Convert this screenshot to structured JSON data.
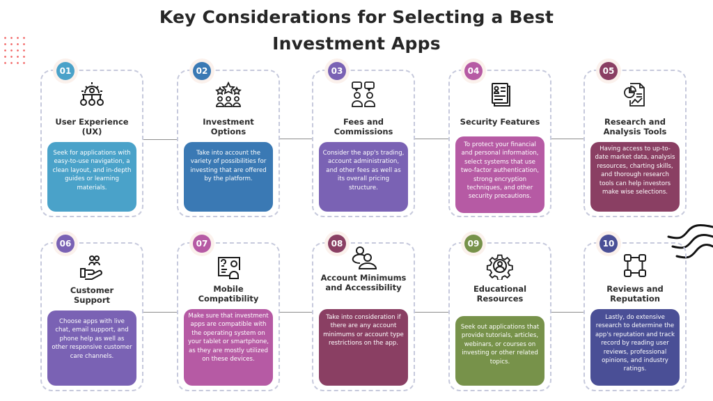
{
  "title": {
    "line1": "Key Considerations for Selecting a Best",
    "line2": "Investment Apps"
  },
  "colors": {
    "c01": "#4aa2c9",
    "c02": "#3a79b4",
    "c03": "#7a62b4",
    "c04": "#b65aa4",
    "c05": "#8a3f63",
    "c06": "#7a62b4",
    "c07": "#b65aa4",
    "c08": "#8a3f63",
    "c09": "#77924a",
    "c10": "#4a4f96",
    "dashed_border": "#c6c9dc",
    "dots": "#f26b6b"
  },
  "cards": [
    {
      "number": "01",
      "icon": "ux-gear-network-icon",
      "heading": "User Experience (UX)",
      "description": "Seek for applications with easy-to-use navigation, a clean layout, and in-depth guides or learning materials."
    },
    {
      "number": "02",
      "icon": "stars-people-icon",
      "heading": "Investment Options",
      "description": "Take into account the variety of possibilities for investing that are offered by the platform."
    },
    {
      "number": "03",
      "icon": "people-chat-icon",
      "heading": "Fees and Commissions",
      "description": "Consider the app's trading, account administration, and other fees as well as its overall pricing structure."
    },
    {
      "number": "04",
      "icon": "profile-document-icon",
      "heading": "Security Features",
      "description": "To protect your financial and personal information, select systems that use two-factor authentication, strong encryption techniques, and other security precautions."
    },
    {
      "number": "05",
      "icon": "report-chart-icon",
      "heading": "Research and Analysis Tools",
      "description": "Having access to up-to-date market data, analysis resources, charting skills, and thorough research tools can help investors make wise selections."
    },
    {
      "number": "06",
      "icon": "hand-people-icon",
      "heading": "Customer Support",
      "description": "Choose apps with live chat, email support, and phone help as well as other responsive customer care channels."
    },
    {
      "number": "07",
      "icon": "profile-card-icon",
      "heading": "Mobile Compatibility",
      "description": "Make sure that investment apps are compatible with the operating system on your tablet or smartphone, as they are mostly utilized on these devices."
    },
    {
      "number": "08",
      "icon": "users-group-icon",
      "heading": "Account Minimums and Accessibility",
      "description": "Take into consideration if there are any account minimums or account type restrictions on the app."
    },
    {
      "number": "09",
      "icon": "gear-user-icon",
      "heading": "Educational Resources",
      "description": "Seek out applications that provide tutorials, articles, webinars, or courses on investing or other related topics."
    },
    {
      "number": "10",
      "icon": "workflow-nodes-icon",
      "heading": "Reviews and Reputation",
      "description": "Lastly, do extensive research to determine the app's reputation and track record by reading user reviews, professional opinions, and industry ratings."
    }
  ]
}
